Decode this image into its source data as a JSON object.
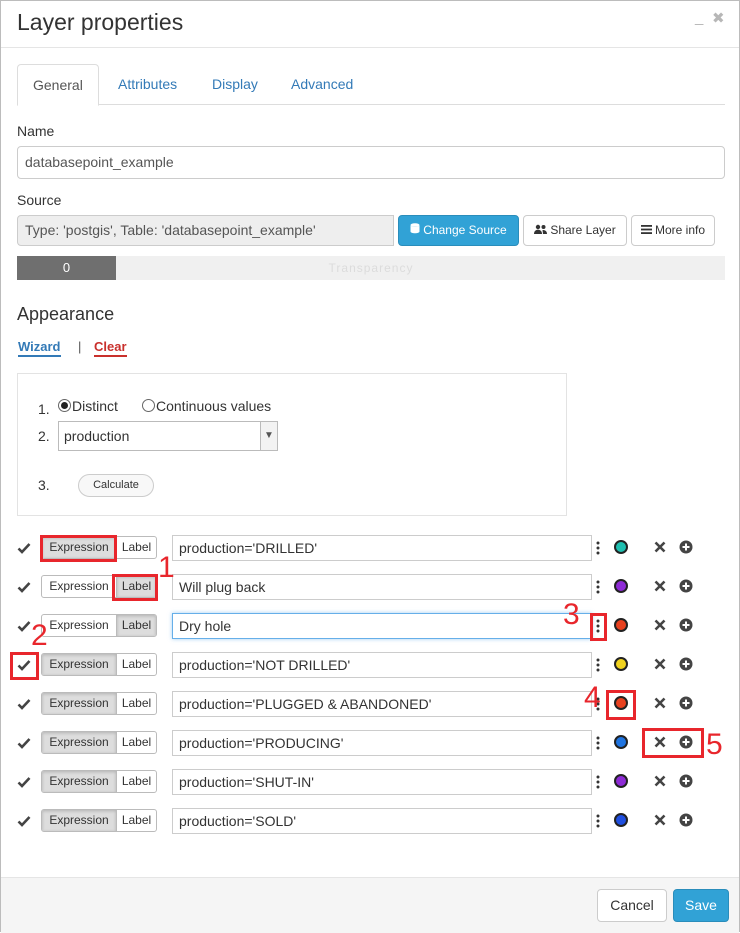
{
  "dialog": {
    "title": "Layer properties",
    "minimize_glyph": "_",
    "close_glyph": "✖"
  },
  "tabs": [
    {
      "label": "General",
      "active": true
    },
    {
      "label": "Attributes",
      "active": false
    },
    {
      "label": "Display",
      "active": false
    },
    {
      "label": "Advanced",
      "active": false
    }
  ],
  "name_section": {
    "label": "Name",
    "value": "databasepoint_example"
  },
  "source_section": {
    "label": "Source",
    "value": "Type: 'postgis', Table: 'databasepoint_example'",
    "change_source_label": "Change Source",
    "share_layer_label": "Share Layer",
    "more_info_label": "More info"
  },
  "transparency": {
    "value_text": "0",
    "value_fraction": 0.14,
    "label": "Transparency"
  },
  "appearance": {
    "heading": "Appearance",
    "wizard_link": "Wizard",
    "separator": "|",
    "clear_link": "Clear",
    "step1_num": "1.",
    "step2_num": "2.",
    "step3_num": "3.",
    "distinct_label": "Distinct",
    "continuous_label": "Continuous values",
    "attribute_selected": "production",
    "calculate_label": "Calculate"
  },
  "rules": [
    {
      "mode": "expression",
      "text": "production='DRILLED'",
      "color": "#1fbfb0",
      "focus": false
    },
    {
      "mode": "label",
      "text": "Will plug back",
      "color": "#8e2bd6",
      "focus": false
    },
    {
      "mode": "label",
      "text": "Dry hole",
      "color": "#e8411f",
      "focus": true
    },
    {
      "mode": "expression",
      "text": "production='NOT DRILLED'",
      "color": "#f0d21e",
      "focus": false
    },
    {
      "mode": "expression",
      "text": "production='PLUGGED & ABANDONED'",
      "color": "#e8411f",
      "focus": false
    },
    {
      "mode": "expression",
      "text": "production='PRODUCING'",
      "color": "#1f74e0",
      "focus": false
    },
    {
      "mode": "expression",
      "text": "production='SHUT-IN'",
      "color": "#8e2bd6",
      "focus": false
    },
    {
      "mode": "expression",
      "text": "production='SOLD'",
      "color": "#1f4fe0",
      "focus": false
    }
  ],
  "rule_labels": {
    "expression": "Expression",
    "label": "Label"
  },
  "annotations": [
    "1",
    "2",
    "3",
    "4",
    "5"
  ],
  "annotation_color": "#e8262c",
  "footer": {
    "cancel_label": "Cancel",
    "save_label": "Save"
  },
  "icons": {
    "check": "check-icon",
    "kebab": "vertical-dots-icon",
    "remove": "close-icon",
    "add": "plus-circle-icon",
    "database": "database-icon",
    "share": "users-icon",
    "info": "list-icon"
  }
}
